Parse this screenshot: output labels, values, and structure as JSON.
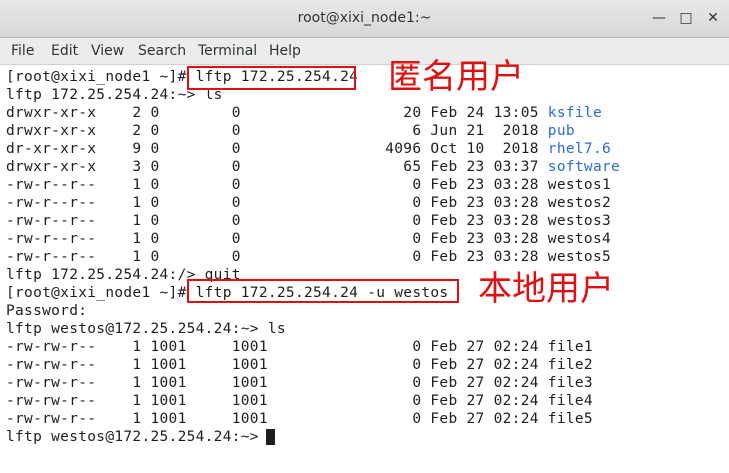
{
  "window": {
    "title": "root@xixi_node1:~",
    "minimize_glyph": "—",
    "maximize_glyph": "□",
    "close_glyph": "✕"
  },
  "menu": [
    "File",
    "Edit",
    "View",
    "Search",
    "Terminal",
    "Help"
  ],
  "terminal": {
    "prompt1": "[root@xixi_node1 ~]# ",
    "cmd1": "lftp 172.25.254.24",
    "lftp_ls1": "lftp 172.25.254.24:~> ls",
    "dir1": [
      {
        "meta": "drwxr-xr-x    2 0        0                  20 Feb 24 13:05 ",
        "name": "ksfile",
        "highlight": true
      },
      {
        "meta": "drwxr-xr-x    2 0        0                   6 Jun 21  2018 ",
        "name": "pub",
        "highlight": true
      },
      {
        "meta": "dr-xr-xr-x    9 0        0                4096 Oct 10  2018 ",
        "name": "rhel7.6",
        "highlight": true
      },
      {
        "meta": "drwxr-xr-x    3 0        0                  65 Feb 23 03:37 ",
        "name": "software",
        "highlight": true
      },
      {
        "meta": "-rw-r--r--    1 0        0                   0 Feb 23 03:28 ",
        "name": "westos1",
        "highlight": false
      },
      {
        "meta": "-rw-r--r--    1 0        0                   0 Feb 23 03:28 ",
        "name": "westos2",
        "highlight": false
      },
      {
        "meta": "-rw-r--r--    1 0        0                   0 Feb 23 03:28 ",
        "name": "westos3",
        "highlight": false
      },
      {
        "meta": "-rw-r--r--    1 0        0                   0 Feb 23 03:28 ",
        "name": "westos4",
        "highlight": false
      },
      {
        "meta": "-rw-r--r--    1 0        0                   0 Feb 23 03:28 ",
        "name": "westos5",
        "highlight": false
      }
    ],
    "quit_line": "lftp 172.25.254.24:/> quit",
    "prompt2": "[root@xixi_node1 ~]# ",
    "cmd2": "lftp 172.25.254.24 -u westos",
    "password_line": "Password:",
    "lftp_ls2": "lftp westos@172.25.254.24:~> ls",
    "dir2": [
      {
        "meta": "-rw-rw-r--    1 1001     1001                0 Feb 27 02:24 ",
        "name": "file1"
      },
      {
        "meta": "-rw-rw-r--    1 1001     1001                0 Feb 27 02:24 ",
        "name": "file2"
      },
      {
        "meta": "-rw-rw-r--    1 1001     1001                0 Feb 27 02:24 ",
        "name": "file3"
      },
      {
        "meta": "-rw-rw-r--    1 1001     1001                0 Feb 27 02:24 ",
        "name": "file4"
      },
      {
        "meta": "-rw-rw-r--    1 1001     1001                0 Feb 27 02:24 ",
        "name": "file5"
      }
    ],
    "final_prompt": "lftp westos@172.25.254.24:~> "
  },
  "annotations": {
    "anonymous": "匿名用户",
    "local": "本地用户",
    "color": "#e01010"
  },
  "colors": {
    "dir_highlight": "#2a6cd6",
    "text": "#1e1e1e",
    "background": "#ffffff"
  }
}
